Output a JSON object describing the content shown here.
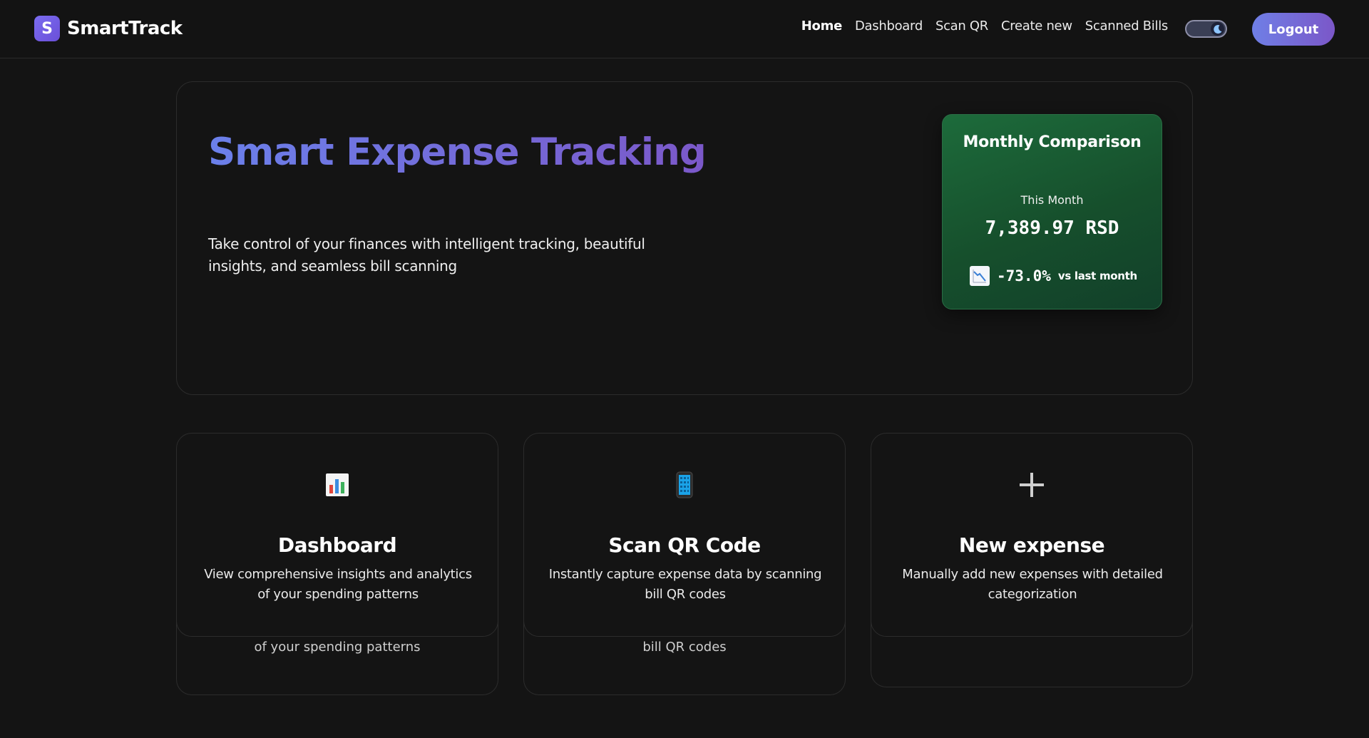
{
  "brand": {
    "logo_letter": "S",
    "name": "SmartTrack"
  },
  "nav": {
    "items": [
      {
        "label": "Home",
        "active": true
      },
      {
        "label": "Dashboard"
      },
      {
        "label": "Scan QR"
      },
      {
        "label": "Create new"
      },
      {
        "label": "Scanned Bills"
      }
    ],
    "theme_toggle": {
      "mode": "dark",
      "icon": "moon-icon"
    },
    "logout_label": "Logout"
  },
  "hero": {
    "title": "Smart Expense Tracking",
    "subtitle": "Take control of your finances with intelligent tracking, beautiful insights, and seamless bill scanning"
  },
  "comparison": {
    "title": "Monthly Comparison",
    "period_label": "This Month",
    "amount": "7,389.97 RSD",
    "change": "-73.0%",
    "change_note": "vs last month",
    "trend_icon": "chart-decreasing-icon"
  },
  "features": [
    {
      "icon": "bar-chart-icon",
      "title": "Dashboard",
      "description": "View comprehensive insights and analytics of your spending patterns",
      "ghost_text": "of your spending patterns"
    },
    {
      "icon": "mobile-phone-icon",
      "title": "Scan QR Code",
      "description": "Instantly capture expense data by scanning bill QR codes",
      "ghost_text": "bill QR codes"
    },
    {
      "icon": "plus-icon",
      "title": "New expense",
      "description": "Manually add new expenses with detailed categorization",
      "ghost_text": ""
    }
  ],
  "colors": {
    "background": "#141414",
    "accent_gradient_start": "#6f7fe6",
    "accent_gradient_end": "#7b57c8",
    "comparison_card": "#1a5c34"
  }
}
